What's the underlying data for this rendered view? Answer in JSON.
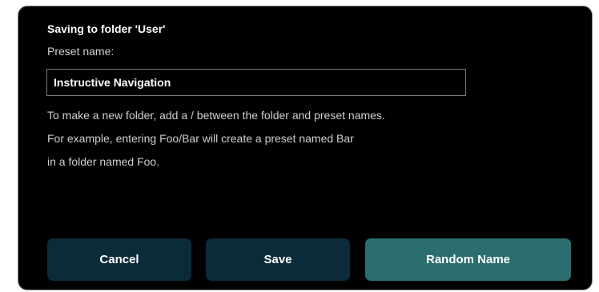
{
  "dialog": {
    "title": "Saving to folder  'User'",
    "preset_label": "Preset name:",
    "name_value": "Instructive Navigation",
    "help_lines": [
      "To make a new folder, add a / between the folder and preset names.",
      "For example, entering Foo/Bar will create a preset named Bar",
      "in a folder named Foo."
    ]
  },
  "buttons": {
    "cancel": "Cancel",
    "save": "Save",
    "random": "Random Name"
  },
  "colors": {
    "background": "#000000",
    "primary_button": "#0b2b3b",
    "accent_button": "#2b6e70"
  }
}
